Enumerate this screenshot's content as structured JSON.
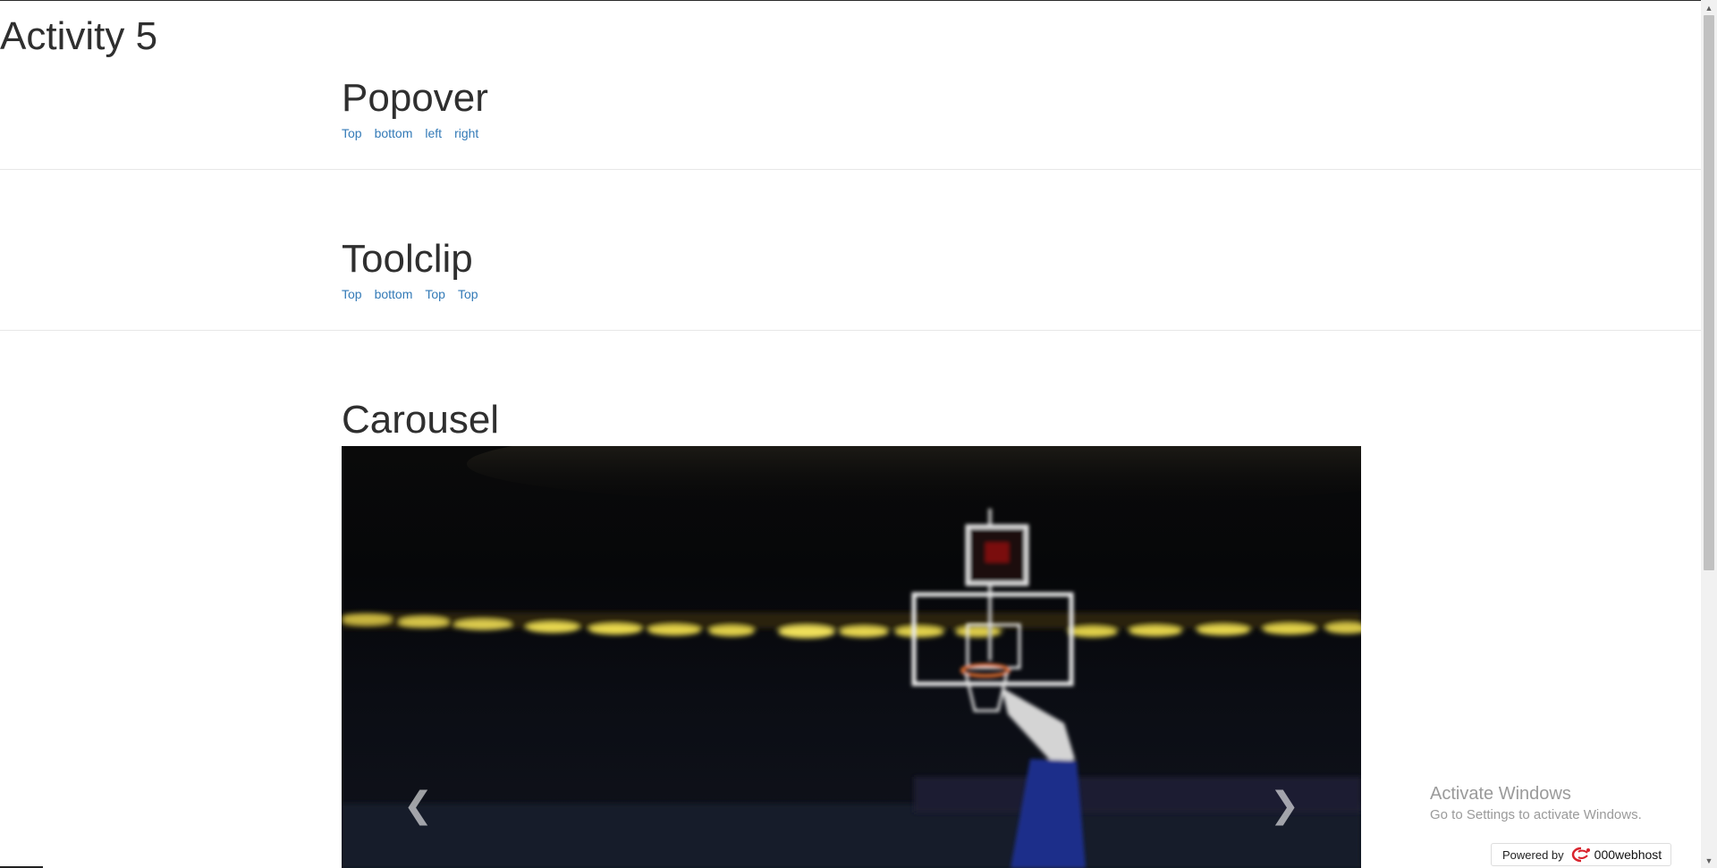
{
  "page": {
    "title": "Activity 5"
  },
  "popover": {
    "heading": "Popover",
    "links": [
      "Top",
      "bottom",
      "left",
      "right"
    ]
  },
  "toolclip": {
    "heading": "Toolclip",
    "links": [
      "Top",
      "bottom",
      "Top",
      "Top"
    ]
  },
  "carousel": {
    "heading": "Carousel",
    "prev_icon": "chevron-left-icon",
    "next_icon": "chevron-right-icon",
    "slide_description": "basketball-arena-hoop"
  },
  "os_watermark": {
    "title": "Activate Windows",
    "subtitle": "Go to Settings to activate Windows."
  },
  "powered_badge": {
    "label": "Powered by",
    "brand": "000webhost",
    "brand_color": "#d9232d"
  }
}
